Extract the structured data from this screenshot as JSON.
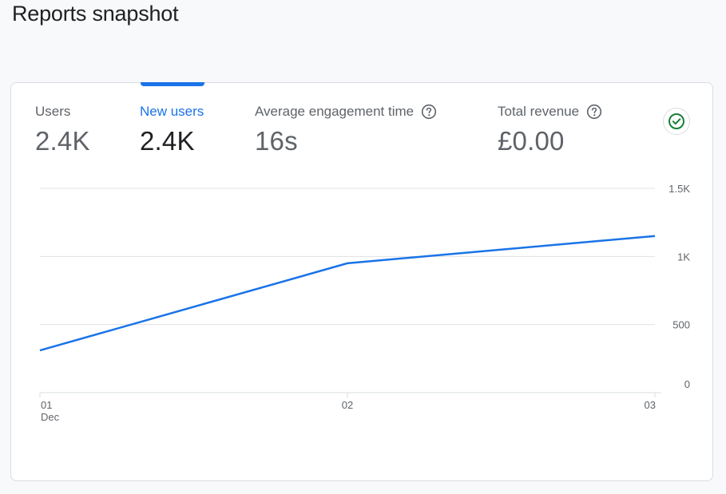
{
  "page": {
    "title": "Reports snapshot"
  },
  "metrics": [
    {
      "label": "Users",
      "value": "2.4K",
      "active": false,
      "help": false
    },
    {
      "label": "New users",
      "value": "2.4K",
      "active": true,
      "help": false
    },
    {
      "label": "Average engagement time",
      "value": "16s",
      "active": false,
      "help": true
    },
    {
      "label": "Total revenue",
      "value": "£0.00",
      "active": false,
      "help": true
    }
  ],
  "status_icon": "check-circle-icon",
  "colors": {
    "accent": "#1a73e8",
    "status_ok": "#188038",
    "muted_text": "#5f6368"
  },
  "chart_data": {
    "type": "line",
    "x": [
      "01",
      "02",
      "03"
    ],
    "x_sublabels": [
      "Dec",
      "",
      ""
    ],
    "series": [
      {
        "values": [
          310,
          950,
          1150
        ]
      }
    ],
    "y_ticks": [
      "0",
      "500",
      "1K",
      "1.5K"
    ],
    "y_tick_values": [
      0,
      500,
      1000,
      1500
    ],
    "ylim": [
      0,
      1500
    ],
    "y_axis_side": "right",
    "grid": true,
    "color": "#1a73e8"
  }
}
